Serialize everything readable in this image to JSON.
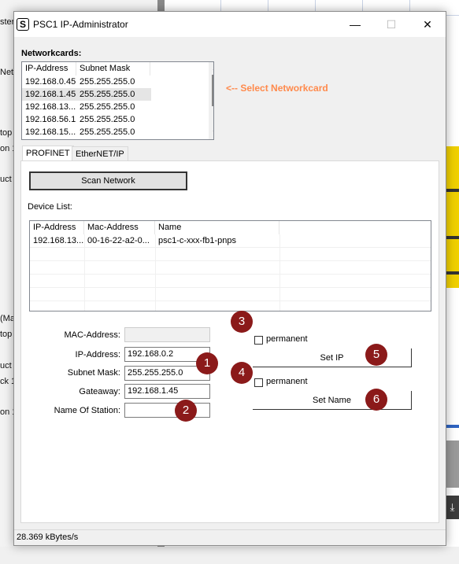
{
  "background": {
    "fragments": [
      "ster",
      "Net",
      "top",
      "on 1",
      "uct",
      "(Ma",
      "top",
      "uct",
      "ck 1",
      "on 1"
    ],
    "download_glyph": "⤓"
  },
  "window": {
    "title": "PSC1 IP-Administrator",
    "app_icon_glyph": "S",
    "minimize_glyph": "—",
    "maximize_glyph": "☐",
    "close_glyph": "✕"
  },
  "networkcards": {
    "label": "Networkcards:",
    "columns": [
      "IP-Address",
      "Subnet Mask"
    ],
    "rows": [
      {
        "ip": "192.168.0.45",
        "mask": "255.255.255.0",
        "selected": false
      },
      {
        "ip": "192.168.1.45",
        "mask": "255.255.255.0",
        "selected": true
      },
      {
        "ip": "192.168.13....",
        "mask": "255.255.255.0",
        "selected": false
      },
      {
        "ip": "192.168.56.1",
        "mask": "255.255.255.0",
        "selected": false
      },
      {
        "ip": "192.168.15....",
        "mask": "255.255.255.0",
        "selected": false
      }
    ],
    "hint": "<-- Select Networkcard"
  },
  "tabs": [
    {
      "label": "PROFINET",
      "active": true
    },
    {
      "label": "EtherNET/IP",
      "active": false
    }
  ],
  "profinet": {
    "scan_button": "Scan Network",
    "device_list_label": "Device List:",
    "device_columns": [
      "IP-Address",
      "Mac-Address",
      "Name"
    ],
    "devices": [
      {
        "ip": "192.168.13....",
        "mac": "00-16-22-a2-0...",
        "name": "psc1-c-xxx-fb1-pnps"
      }
    ],
    "mac_label": "MAC-Address:",
    "mac_value": "",
    "ip_label": "IP-Address:",
    "ip_value": "192.168.0.2",
    "subnet_label": "Subnet Mask:",
    "subnet_value": "255.255.255.0",
    "gateway_label": "Gateaway:",
    "gateway_value": "192.168.1.45",
    "station_label": "Name Of Station:",
    "station_value": "",
    "permanent_label_1": "permanent",
    "permanent_label_2": "permanent",
    "set_ip_button": "Set IP",
    "set_name_button": "Set Name"
  },
  "badges": [
    "1",
    "2",
    "3",
    "4",
    "5",
    "6"
  ],
  "statusbar": {
    "text": "28.369 kBytes/s"
  },
  "colors": {
    "hint": "#ff8a4c",
    "badge": "#8b1a1a",
    "selection": "#e5e5e5"
  }
}
